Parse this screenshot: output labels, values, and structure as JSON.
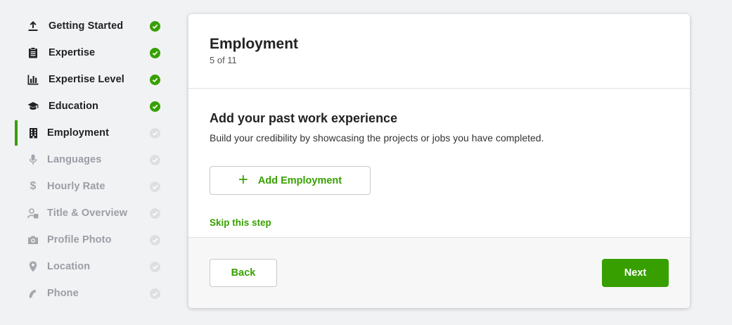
{
  "sidebar": {
    "steps": [
      {
        "label": "Getting Started",
        "icon": "upload-icon",
        "state": "done"
      },
      {
        "label": "Expertise",
        "icon": "clipboard-icon",
        "state": "done"
      },
      {
        "label": "Expertise Level",
        "icon": "bar-chart-icon",
        "state": "done"
      },
      {
        "label": "Education",
        "icon": "graduation-cap-icon",
        "state": "done"
      },
      {
        "label": "Employment",
        "icon": "building-icon",
        "state": "current"
      },
      {
        "label": "Languages",
        "icon": "microphone-icon",
        "state": "todo"
      },
      {
        "label": "Hourly Rate",
        "icon": "dollar-icon",
        "state": "todo"
      },
      {
        "label": "Title & Overview",
        "icon": "user-icon",
        "state": "todo"
      },
      {
        "label": "Profile Photo",
        "icon": "camera-icon",
        "state": "todo"
      },
      {
        "label": "Location",
        "icon": "map-pin-icon",
        "state": "todo"
      },
      {
        "label": "Phone",
        "icon": "phone-icon",
        "state": "todo"
      }
    ]
  },
  "card": {
    "title": "Employment",
    "step_counter": "5 of 11",
    "section_title": "Add your past work experience",
    "section_description": "Build your credibility by showcasing the projects or jobs you have completed.",
    "add_button_label": "Add Employment",
    "skip_label": "Skip this step",
    "back_label": "Back",
    "next_label": "Next"
  },
  "colors": {
    "accent": "#37a000",
    "background": "#f1f2f4",
    "muted_text": "#9a9ea4"
  }
}
